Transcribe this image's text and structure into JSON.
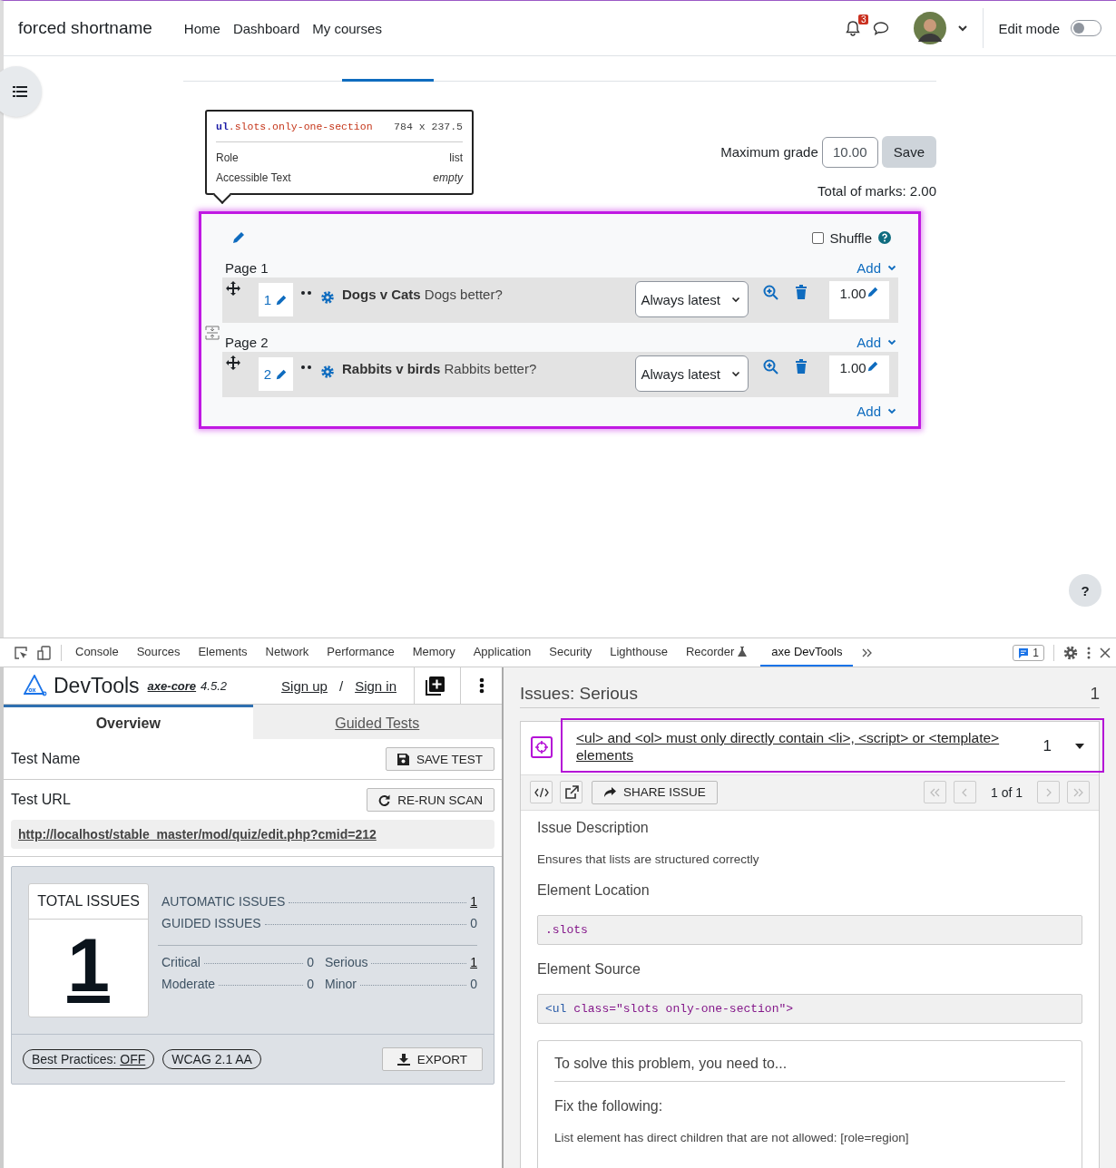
{
  "site": {
    "name": "forced shortname",
    "nav": [
      "Home",
      "Dashboard",
      "My courses"
    ],
    "notification_count": "3",
    "edit_mode": {
      "label": "Edit mode",
      "on": false
    }
  },
  "inspector_tooltip": {
    "tag": "ul",
    "classes": ".slots.only-one-section",
    "size": "784 x 237.5",
    "rows": [
      {
        "label": "Role",
        "value": "list",
        "kind": "plain"
      },
      {
        "label": "Accessible Text",
        "value": "empty",
        "kind": "italic"
      }
    ]
  },
  "grade": {
    "label": "Maximum grade",
    "value": "10.00",
    "save": "Save",
    "total": "Total of marks: 2.00"
  },
  "shuffle": {
    "label": "Shuffle",
    "checked": false
  },
  "pages": [
    {
      "title": "Page 1",
      "add": "Add",
      "slots": [
        {
          "number": "1",
          "name": "Dogs v Cats",
          "text": "Dogs better?",
          "version": "Always latest",
          "mark": "1.00"
        }
      ]
    },
    {
      "title": "Page 2",
      "add": "Add",
      "slots": [
        {
          "number": "2",
          "name": "Rabbits v birds",
          "text": "Rabbits better?",
          "version": "Always latest",
          "mark": "1.00"
        }
      ]
    }
  ],
  "final_add": "Add",
  "help_button": "?",
  "devtools": {
    "tabs": [
      {
        "label": "Console",
        "selected": false,
        "flask": false
      },
      {
        "label": "Sources",
        "selected": false,
        "flask": false
      },
      {
        "label": "Elements",
        "selected": false,
        "flask": false
      },
      {
        "label": "Network",
        "selected": false,
        "flask": false
      },
      {
        "label": "Performance",
        "selected": false,
        "flask": false
      },
      {
        "label": "Memory",
        "selected": false,
        "flask": false
      },
      {
        "label": "Application",
        "selected": false,
        "flask": false
      },
      {
        "label": "Security",
        "selected": false,
        "flask": false
      },
      {
        "label": "Lighthouse",
        "selected": false,
        "flask": false
      },
      {
        "label": "Recorder",
        "selected": false,
        "flask": true
      },
      {
        "label": "axe DevTools",
        "selected": true,
        "flask": false
      }
    ],
    "issues_badge": "1"
  },
  "axe": {
    "brand": "DevTools",
    "core": "axe-core",
    "version": "4.5.2",
    "sign_up": "Sign up",
    "separator": "/",
    "sign_in": "Sign in",
    "tabs": [
      {
        "label": "Overview",
        "selected": true
      },
      {
        "label": "Guided Tests",
        "selected": false
      }
    ],
    "test_name_label": "Test Name",
    "save_test": "SAVE TEST",
    "test_url_label": "Test URL",
    "rerun": "RE-RUN SCAN",
    "url": "http://localhost/stable_master/mod/quiz/edit.php?cmid=212",
    "total_label": "TOTAL ISSUES",
    "total": "1",
    "issue_counts": [
      {
        "label": "AUTOMATIC ISSUES",
        "value": "1",
        "linked": true
      },
      {
        "label": "GUIDED ISSUES",
        "value": "0",
        "linked": false
      }
    ],
    "severities": [
      {
        "label": "Critical",
        "value": "0",
        "linked": false
      },
      {
        "label": "Serious",
        "value": "1",
        "linked": true
      },
      {
        "label": "Moderate",
        "value": "0",
        "linked": false
      },
      {
        "label": "Minor",
        "value": "0",
        "linked": false
      }
    ],
    "best_practices": {
      "label": "Best Practices:",
      "value": "OFF"
    },
    "standard": "WCAG 2.1 AA",
    "export": "EXPORT"
  },
  "issues": {
    "title": "Issues: Serious",
    "count": "1",
    "issue": {
      "title": "<ul> and <ol> must only directly contain <li>, <script> or <template> elements",
      "count": "1",
      "share": "SHARE ISSUE",
      "pager": "1 of 1",
      "description_heading": "Issue Description",
      "description": "Ensures that lists are structured correctly",
      "location_heading": "Element Location",
      "location": ".slots",
      "source_heading": "Element Source",
      "source_tag": "<ul",
      "source_rest": " class=\"slots only-one-section\">",
      "solve_heading": "To solve this problem, you need to...",
      "fix_heading": "Fix the following:",
      "fix": "List element has direct children that are not allowed: [role=region]"
    }
  }
}
